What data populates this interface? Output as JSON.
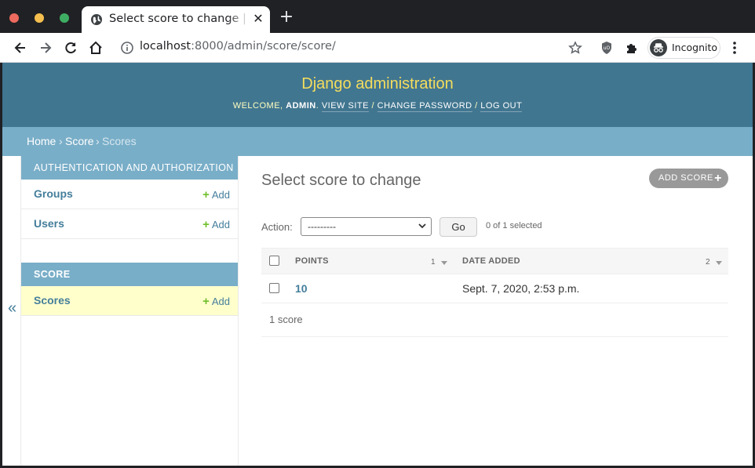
{
  "browser": {
    "tab_title": "Select score to change | Dj",
    "close_glyph": "✕",
    "new_tab_glyph": "+",
    "url_host": "localhost",
    "url_path": ":8000/admin/score/score/",
    "incognito_label": "Incognito"
  },
  "header": {
    "brand": "Django administration",
    "welcome": "WELCOME, ",
    "user": "ADMIN",
    "dot": ". ",
    "view_site": "VIEW SITE",
    "sep": " / ",
    "change_password": "CHANGE PASSWORD",
    "log_out": "LOG OUT"
  },
  "breadcrumbs": {
    "home": "Home",
    "app": "Score",
    "current": "Scores",
    "sep": "›"
  },
  "sidebar": {
    "toggle": "«",
    "modules": [
      {
        "caption": "AUTHENTICATION AND AUTHORIZATION",
        "items": [
          {
            "name": "Groups",
            "add": "Add"
          },
          {
            "name": "Users",
            "add": "Add"
          }
        ]
      },
      {
        "caption": "SCORE",
        "items": [
          {
            "name": "Scores",
            "add": "Add"
          }
        ]
      }
    ],
    "plus": "+"
  },
  "content": {
    "title": "Select score to change",
    "add_button": "ADD SCORE",
    "action_label": "Action:",
    "action_value": "---------",
    "go": "Go",
    "selected": "0 of 1 selected",
    "columns": [
      {
        "label": "POINTS",
        "sort": "1"
      },
      {
        "label": "DATE ADDED",
        "sort": "2"
      }
    ],
    "rows": [
      {
        "points": "10",
        "date_added": "Sept. 7, 2020, 2:53 p.m."
      }
    ],
    "count": "1 score"
  },
  "colors": {
    "header": "#417690",
    "breadcrumbs": "#79aec8",
    "brand": "#f5dd5d",
    "link": "#447e9b",
    "add_green": "#70bf2b",
    "selected_row": "#ffffcc"
  }
}
